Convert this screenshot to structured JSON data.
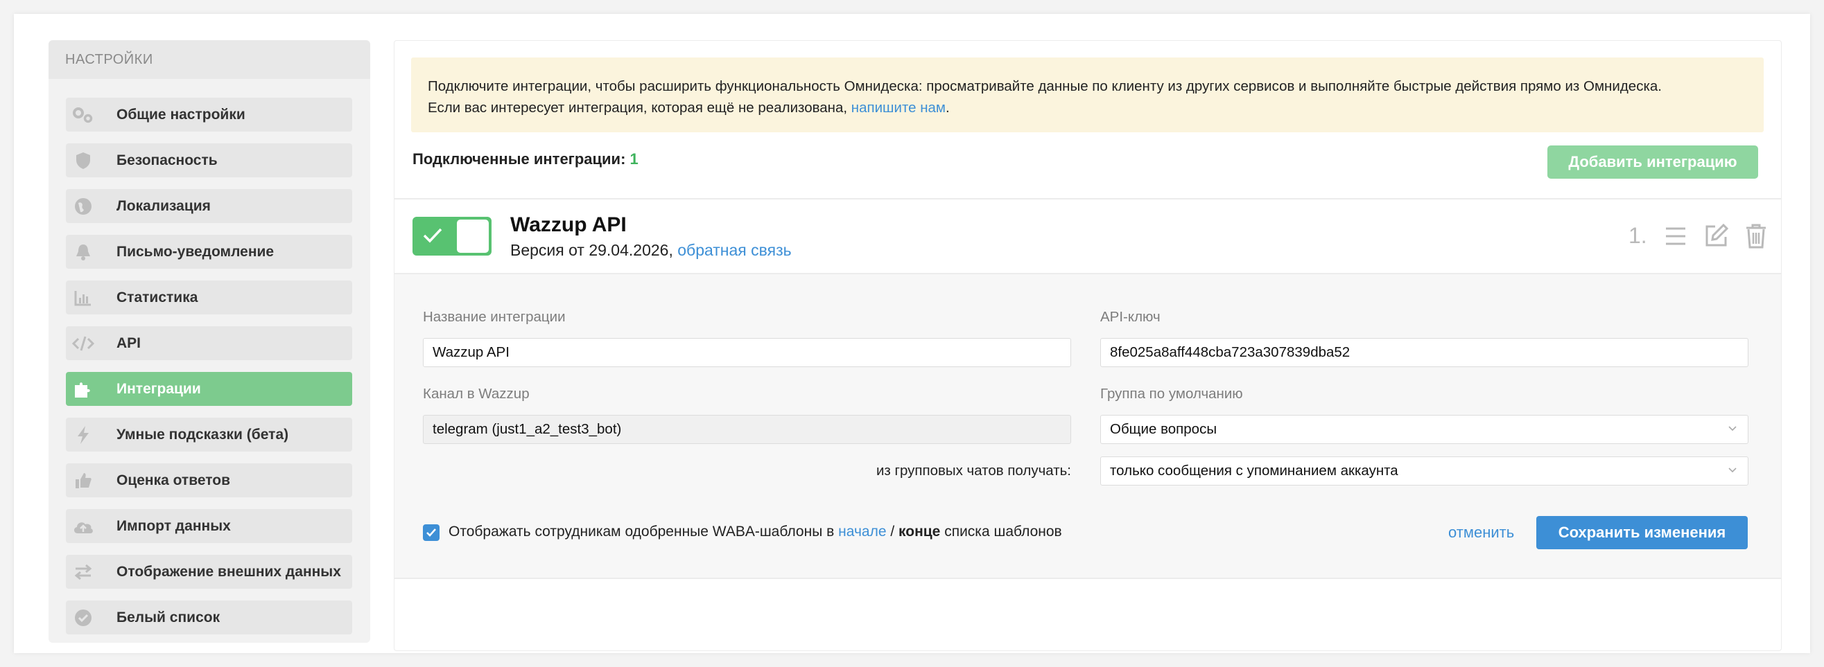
{
  "sidebar": {
    "title": "НАСТРОЙКИ",
    "items": [
      {
        "label": "Общие настройки",
        "icon": "gears-icon"
      },
      {
        "label": "Безопасность",
        "icon": "shield-icon"
      },
      {
        "label": "Локализация",
        "icon": "globe-icon"
      },
      {
        "label": "Письмо-уведомление",
        "icon": "bell-icon"
      },
      {
        "label": "Статистика",
        "icon": "bar-chart-icon"
      },
      {
        "label": "API",
        "icon": "code-icon"
      },
      {
        "label": "Интеграции",
        "icon": "puzzle-icon",
        "active": true
      },
      {
        "label": "Умные подсказки (бета)",
        "icon": "lightning-icon"
      },
      {
        "label": "Оценка ответов",
        "icon": "thumbs-up-icon"
      },
      {
        "label": "Импорт данных",
        "icon": "cloud-upload-icon"
      },
      {
        "label": "Отображение внешних данных",
        "icon": "exchange-icon"
      },
      {
        "label": "Белый список",
        "icon": "check-circle-icon"
      }
    ]
  },
  "notice": {
    "line1": "Подключите интеграции, чтобы расширить функциональность Омнидеска: просматривайте данные по клиенту из других сервисов и выполняйте быстрые действия прямо из Омнидеска.",
    "line2_prefix": "Если вас интересует интеграция, которая ещё не реализована, ",
    "line2_link": "напишите нам",
    "line2_suffix": "."
  },
  "connected": {
    "label": "Подключенные интеграции: ",
    "count": "1"
  },
  "add_button": "Добавить интеграцию",
  "integration": {
    "name": "Wazzup API",
    "version_prefix": "Версия от 29.04.2026, ",
    "feedback_link": "обратная связь",
    "order": "1.",
    "enabled": true
  },
  "form": {
    "name_label": "Название интеграции",
    "name_value": "Wazzup API",
    "key_label": "API-ключ",
    "key_value": "8fe025a8aff448cba723a307839dba52",
    "channel_label": "Канал в Wazzup",
    "channel_value": "telegram (just1_a2_test3_bot)",
    "group_label": "Группа по умолчанию",
    "group_value": "Общие вопросы",
    "group_chats_label": "из групповых чатов получать:",
    "group_chats_value": "только сообщения с упоминанием аккаунта",
    "waba_prefix": "Отображать сотрудникам одобренные WABA-шаблоны в ",
    "waba_start": "начале",
    "waba_sep": " / ",
    "waba_end": "конце",
    "waba_suffix": " списка шаблонов",
    "waba_checked": true,
    "cancel": "отменить",
    "save": "Сохранить изменения"
  },
  "colors": {
    "accent_green": "#58c271",
    "link_blue": "#3d8fd6",
    "notice_bg": "#fbf4dd"
  }
}
